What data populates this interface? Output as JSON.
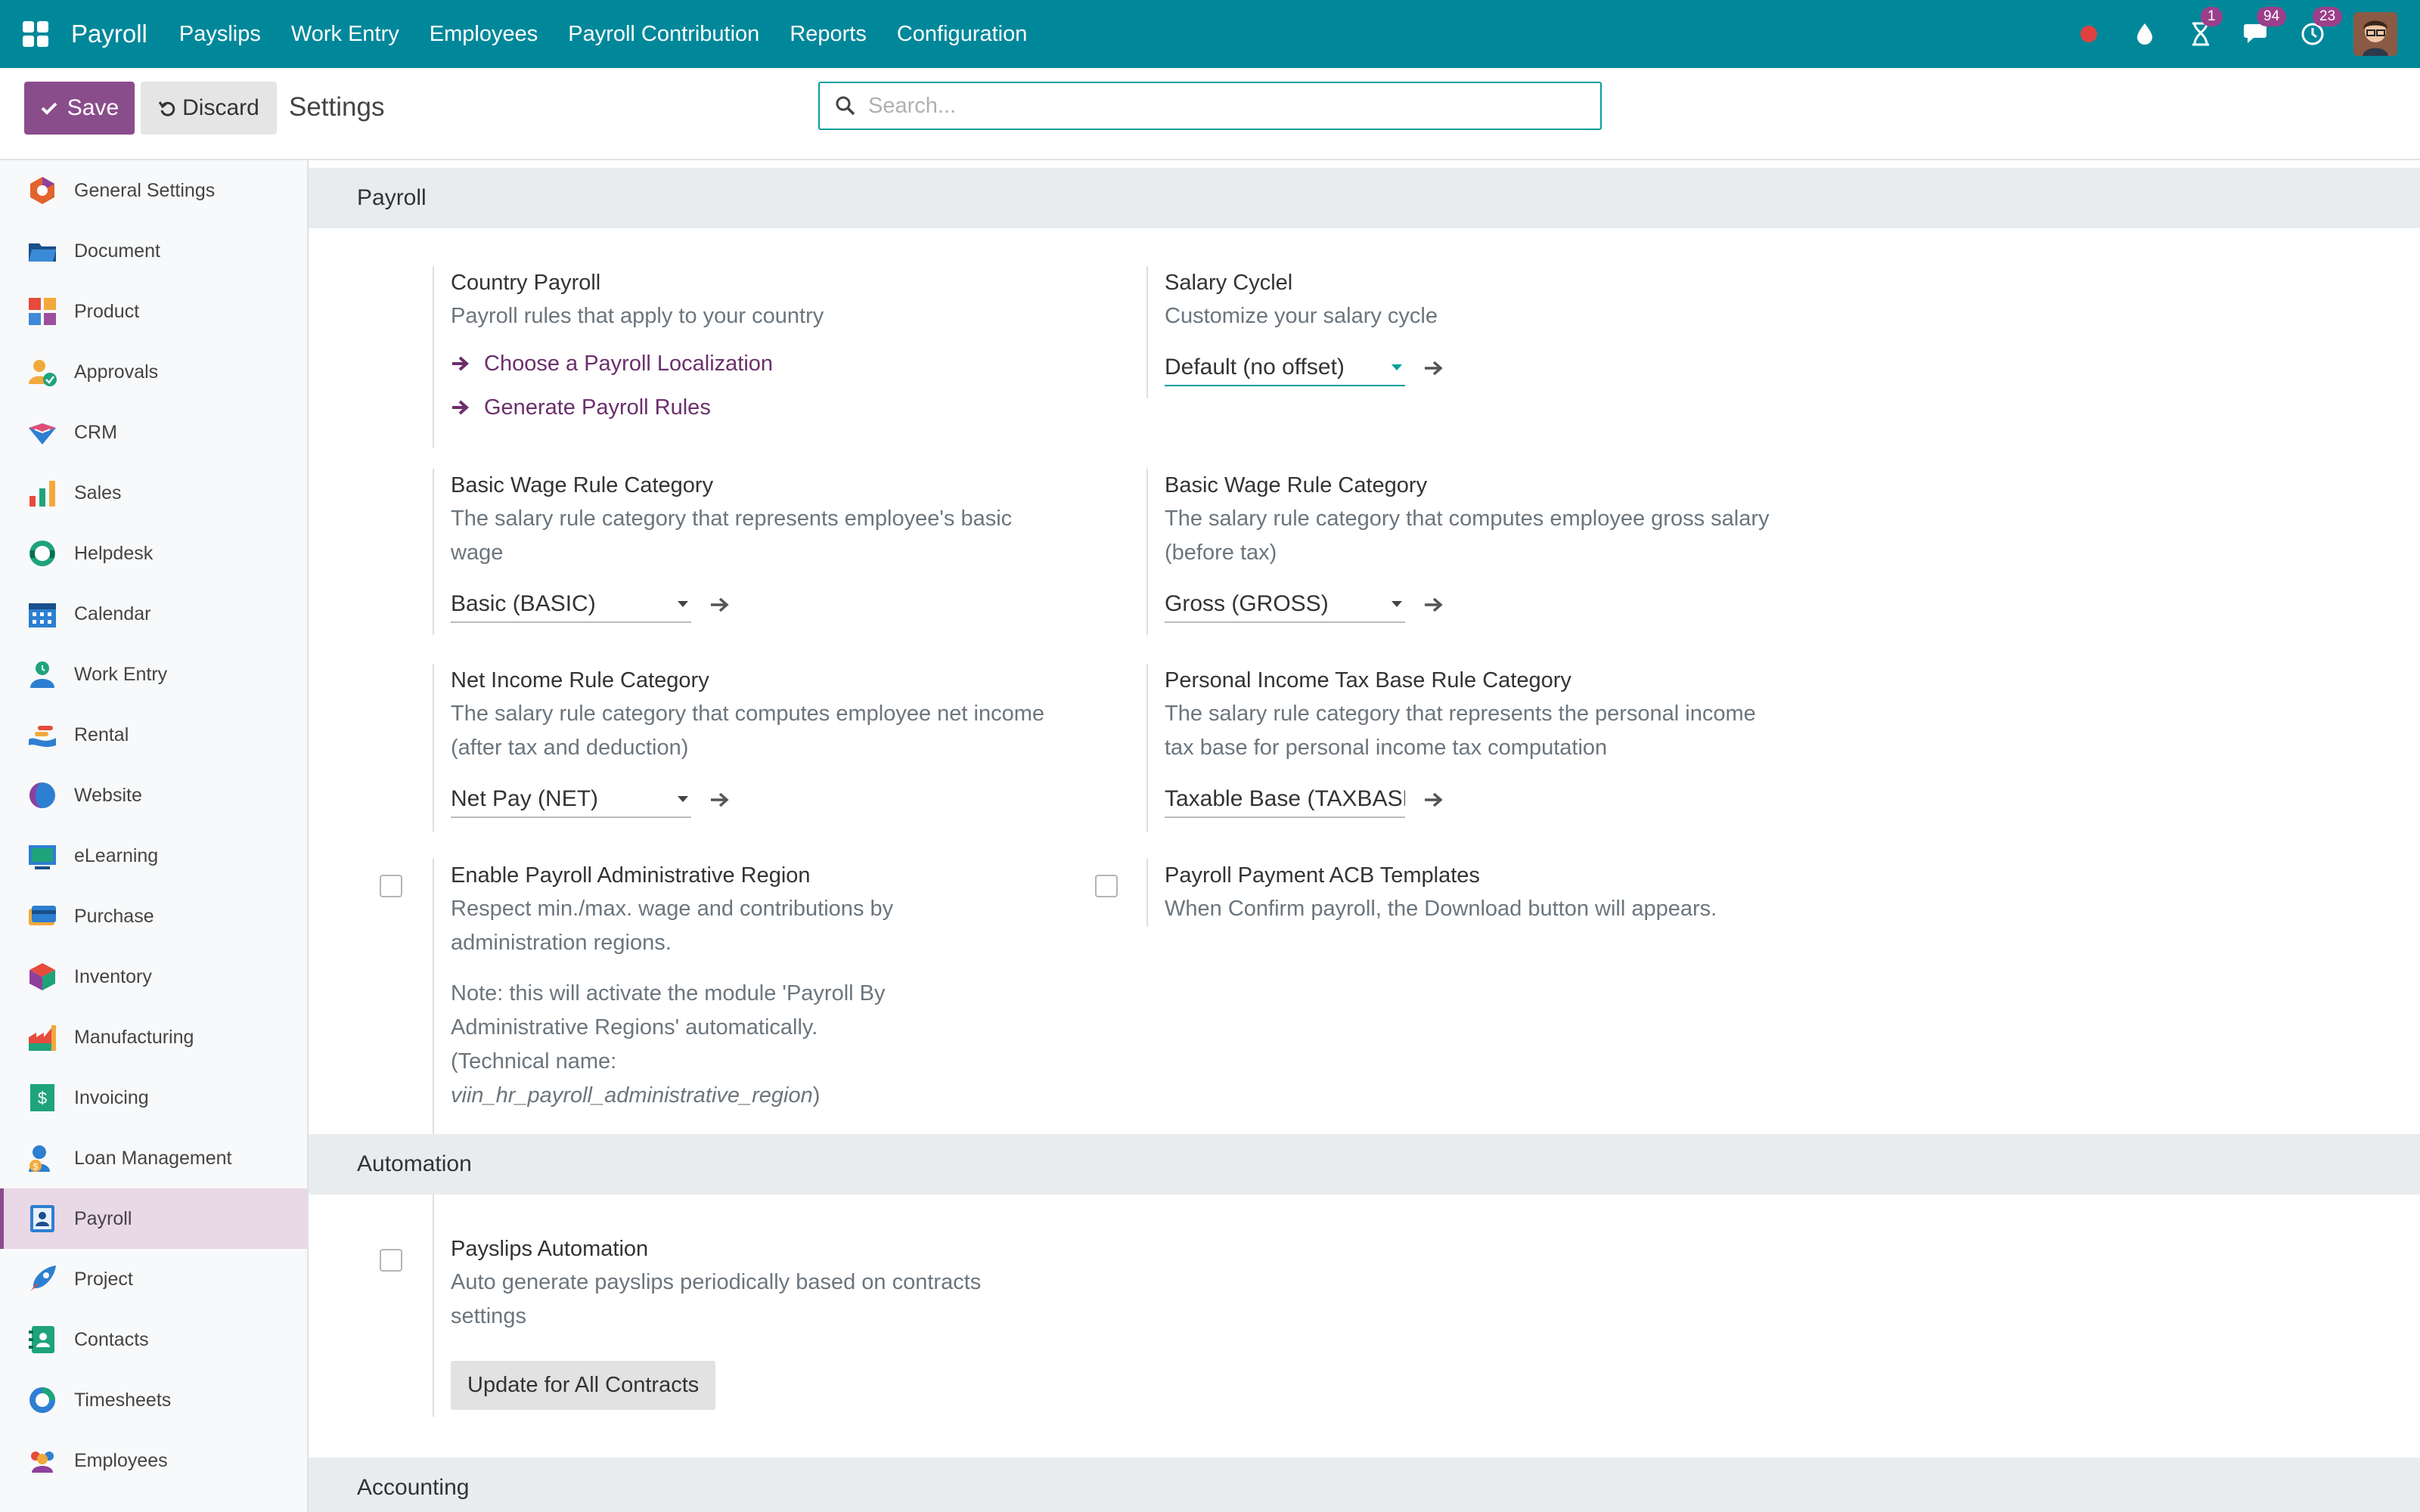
{
  "navbar": {
    "brand": "Payroll",
    "menu": [
      "Payslips",
      "Work Entry",
      "Employees",
      "Payroll Contribution",
      "Reports",
      "Configuration"
    ],
    "activities_badge": "1",
    "messages_badge": "94",
    "updates_badge": "23",
    "bg_color": "#00889a"
  },
  "control": {
    "save_label": "Save",
    "discard_label": "Discard",
    "title": "Settings",
    "search_placeholder": "Search...",
    "accent_color": "#8a4d8c"
  },
  "sidebar": {
    "items": [
      {
        "label": "General Settings",
        "icon": "general-settings-icon"
      },
      {
        "label": "Document",
        "icon": "document-icon"
      },
      {
        "label": "Product",
        "icon": "product-icon"
      },
      {
        "label": "Approvals",
        "icon": "approvals-icon"
      },
      {
        "label": "CRM",
        "icon": "crm-icon"
      },
      {
        "label": "Sales",
        "icon": "sales-icon"
      },
      {
        "label": "Helpdesk",
        "icon": "helpdesk-icon"
      },
      {
        "label": "Calendar",
        "icon": "calendar-icon"
      },
      {
        "label": "Work Entry",
        "icon": "work-entry-icon"
      },
      {
        "label": "Rental",
        "icon": "rental-icon"
      },
      {
        "label": "Website",
        "icon": "website-icon"
      },
      {
        "label": "eLearning",
        "icon": "elearning-icon"
      },
      {
        "label": "Purchase",
        "icon": "purchase-icon"
      },
      {
        "label": "Inventory",
        "icon": "inventory-icon"
      },
      {
        "label": "Manufacturing",
        "icon": "manufacturing-icon"
      },
      {
        "label": "Invoicing",
        "icon": "invoicing-icon"
      },
      {
        "label": "Loan Management",
        "icon": "loan-management-icon"
      },
      {
        "label": "Payroll",
        "icon": "payroll-icon",
        "active": true
      },
      {
        "label": "Project",
        "icon": "project-icon"
      },
      {
        "label": "Contacts",
        "icon": "contacts-icon"
      },
      {
        "label": "Timesheets",
        "icon": "timesheets-icon"
      },
      {
        "label": "Employees",
        "icon": "employees-icon"
      }
    ]
  },
  "sections": {
    "payroll": "Payroll",
    "automation": "Automation",
    "accounting": "Accounting"
  },
  "settings": {
    "country_payroll": {
      "title": "Country Payroll",
      "desc": "Payroll rules that apply to your country",
      "link1": "Choose a Payroll Localization",
      "link2": "Generate Payroll Rules"
    },
    "salary_cycle": {
      "title": "Salary Cyclel",
      "desc": "Customize your salary cycle",
      "value": "Default (no offset)"
    },
    "basic_wage": {
      "title": "Basic Wage Rule Category",
      "desc": "The salary rule category that represents employee's basic wage",
      "value": "Basic (BASIC)"
    },
    "gross_wage": {
      "title": "Basic Wage Rule Category",
      "desc": "The salary rule category that computes employee gross salary (before tax)",
      "value": "Gross (GROSS)"
    },
    "net_income": {
      "title": "Net Income Rule Category",
      "desc": "The salary rule category that computes employee net income (after tax and deduction)",
      "value": "Net Pay (NET)"
    },
    "pit_base": {
      "title": "Personal Income Tax Base Rule Category",
      "desc": "The salary rule category that represents the personal income tax base for personal income tax computation",
      "value": "Taxable Base (TAXBASE)"
    },
    "admin_region": {
      "title": "Enable Payroll Administrative Region",
      "desc": "Respect min./max. wage and contributions by administration regions.",
      "note": "Note: this will activate the module 'Payroll By Administrative Regions' automatically.",
      "tech_prefix": "(Technical name: ",
      "tech_name": "viin_hr_payroll_administrative_region",
      "tech_suffix": ")",
      "checked": false
    },
    "acb_templates": {
      "title": "Payroll Payment ACB Templates",
      "desc": "When Confirm payroll, the Download button will appears.",
      "checked": false
    },
    "payslips_automation": {
      "title": "Payslips Automation",
      "desc": "Auto generate payslips periodically based on contracts settings",
      "button": "Update for All Contracts",
      "checked": false
    }
  }
}
